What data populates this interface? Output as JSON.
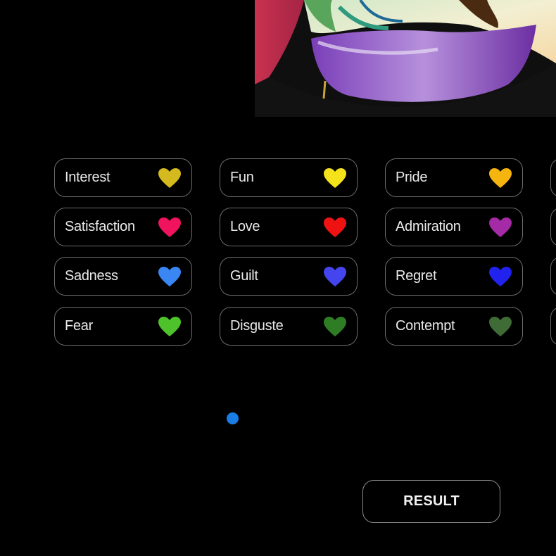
{
  "painting": {
    "alt_icon": "painting-thumbnail"
  },
  "emotions": {
    "interest": {
      "label": "Interest",
      "color": "#d4b91f"
    },
    "fun": {
      "label": "Fun",
      "color": "#f4e21a"
    },
    "pride": {
      "label": "Pride",
      "color": "#f5b40e"
    },
    "satisfaction": {
      "label": "Satisfaction",
      "color": "#f0135e"
    },
    "love": {
      "label": "Love",
      "color": "#ee1212"
    },
    "admiration": {
      "label": "Admiration",
      "color": "#a42aa6"
    },
    "sadness": {
      "label": "Sadness",
      "color": "#3a86f2"
    },
    "guilt": {
      "label": "Guilt",
      "color": "#4545f0"
    },
    "regret": {
      "label": "Regret",
      "color": "#2222ee"
    },
    "fear": {
      "label": "Fear",
      "color": "#4ec22a"
    },
    "disguste": {
      "label": "Disguste",
      "color": "#2e7d24"
    },
    "contempt": {
      "label": "Contempt",
      "color": "#3f6b37"
    }
  },
  "pagination": {
    "active_color": "#1a7de6"
  },
  "result_button": {
    "label": "RESULT"
  }
}
